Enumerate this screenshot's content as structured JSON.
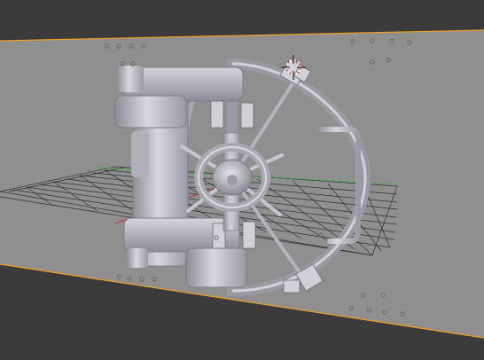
{
  "app": {
    "name": "",
    "view": "3D viewport"
  },
  "viewport": {
    "background_color": "#3b3b3b",
    "camera_frame_color": "#8f8f8f",
    "camera_border_color": "#f0a020",
    "grid_color": "#2a2a2a",
    "axis_x_color": "#c83232",
    "axis_y_color": "#28b428",
    "model_color": "#b9b9c3",
    "selected_highlight_color": "#f07020",
    "hud_text": ""
  },
  "objects": [
    {
      "name": "vault-door",
      "type": "mesh",
      "selected": false
    },
    {
      "name": "vault-wheel",
      "type": "mesh",
      "selected": false
    },
    {
      "name": "vault-hinge",
      "type": "mesh",
      "selected": false
    },
    {
      "name": "vault-handle",
      "type": "mesh",
      "selected": false
    }
  ],
  "cursor_3d": {
    "icon": "3d-cursor-icon"
  },
  "empties": {
    "icon": "empty-marker-icon"
  }
}
